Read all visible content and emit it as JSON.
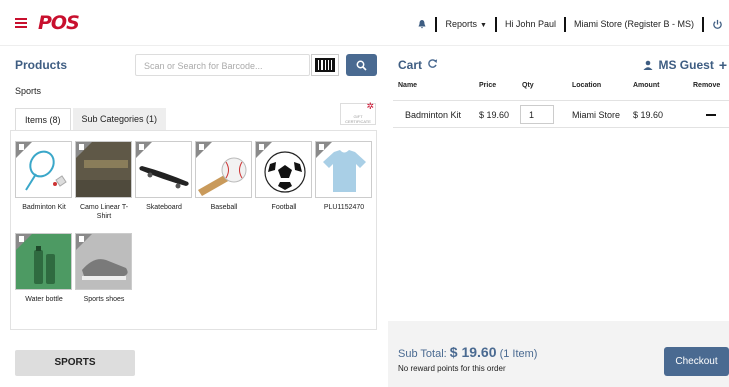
{
  "header": {
    "logo_text": "POS",
    "reports_label": "Reports",
    "user_label": "Hi John Paul",
    "store_label": "Miami Store (Register B - MS)",
    "icons": [
      "menu-icon",
      "bell-icon",
      "power-icon"
    ],
    "brand_color": "#c8102e"
  },
  "products": {
    "title": "Products",
    "search_placeholder": "Scan or Search for Barcode...",
    "breadcrumb": "Sports",
    "tabs": [
      {
        "label": "Items (8)",
        "active": true
      },
      {
        "label": "Sub Categories (1)",
        "active": false
      }
    ],
    "gift_label": "GIFT CERTIFICATE",
    "items": [
      {
        "name": "Badminton Kit",
        "icon": "badminton-icon"
      },
      {
        "name": "Camo Linear T-Shirt",
        "icon": "tshirt-icon"
      },
      {
        "name": "Skateboard",
        "icon": "skateboard-icon"
      },
      {
        "name": "Baseball",
        "icon": "baseball-icon"
      },
      {
        "name": "Football",
        "icon": "football-icon"
      },
      {
        "name": "PLU1152470",
        "icon": "tshirt-icon"
      },
      {
        "name": "Water bottle",
        "icon": "bottle-icon"
      },
      {
        "name": "Sports shoes",
        "icon": "shoe-icon"
      }
    ],
    "category_button": "SPORTS"
  },
  "cart": {
    "title": "Cart",
    "customer": "MS Guest",
    "columns": [
      "Name",
      "Price",
      "Qty",
      "Location",
      "Amount",
      "Remove"
    ],
    "rows": [
      {
        "name": "Badminton Kit",
        "price": "$ 19.60",
        "qty": "1",
        "location": "Miami Store",
        "amount": "$ 19.60"
      }
    ],
    "subtotal_label": "Sub Total:",
    "subtotal_value": "$ 19.60",
    "subtotal_count": "(1 Item)",
    "reward_text": "No reward points for this order",
    "checkout_label": "Checkout",
    "accent_color": "#4a6a91"
  }
}
